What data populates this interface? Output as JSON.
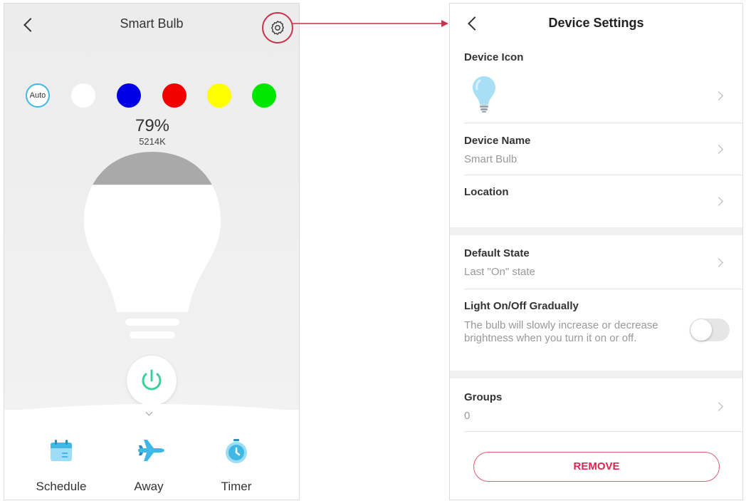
{
  "left_screen": {
    "title": "Smart Bulb",
    "color_options": [
      {
        "label": "Auto",
        "color": "#ffffff"
      },
      {
        "color": "#ffffff"
      },
      {
        "color": "#0000e6"
      },
      {
        "color": "#f00000"
      },
      {
        "color": "#ffff00"
      },
      {
        "color": "#00e600"
      }
    ],
    "brightness": "79%",
    "color_temperature": "5214K",
    "brightness_fraction": 0.79,
    "tabs": [
      {
        "label": "Schedule",
        "icon": "calendar-icon"
      },
      {
        "label": "Away",
        "icon": "airplane-icon"
      },
      {
        "label": "Timer",
        "icon": "stopwatch-icon"
      }
    ]
  },
  "right_screen": {
    "title": "Device Settings",
    "device_icon_label": "Device Icon",
    "device_name_label": "Device Name",
    "device_name_value": "Smart Bulb",
    "location_label": "Location",
    "location_value": "",
    "default_state_label": "Default State",
    "default_state_value": "Last \"On\" state",
    "gradual_label": "Light On/Off Gradually",
    "gradual_description": "The bulb will slowly increase or decrease brightness when you turn it on or off.",
    "gradual_enabled": false,
    "groups_label": "Groups",
    "groups_value": "0",
    "remove_label": "REMOVE"
  },
  "colors": {
    "accent_red": "#d9274b",
    "power_green": "#3ccf9a",
    "icon_blue": "#40b8e6"
  }
}
